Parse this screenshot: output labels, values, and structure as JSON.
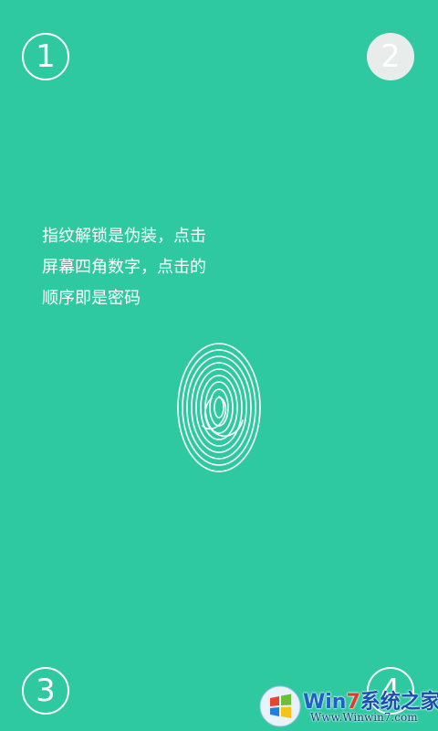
{
  "corners": {
    "top_left": "1",
    "top_right": "2",
    "bottom_left": "3",
    "bottom_right": "4"
  },
  "hint": {
    "line1": "指纹解锁是伪装，点击",
    "line2": "屏幕四角数字，点击的",
    "line3": "顺序即是密码"
  },
  "colors": {
    "background": "#2ec9a0",
    "active_digit": "#e8ecea",
    "foreground": "#ffffff"
  },
  "active_digit": "2",
  "icons": {
    "fingerprint": "fingerprint-icon",
    "watermark_logo": "windows-logo-icon"
  },
  "watermark": {
    "title_prefix": "Win",
    "title_seven": "7",
    "title_cn": "系统之家",
    "url": "Www.Winwin7.com"
  }
}
